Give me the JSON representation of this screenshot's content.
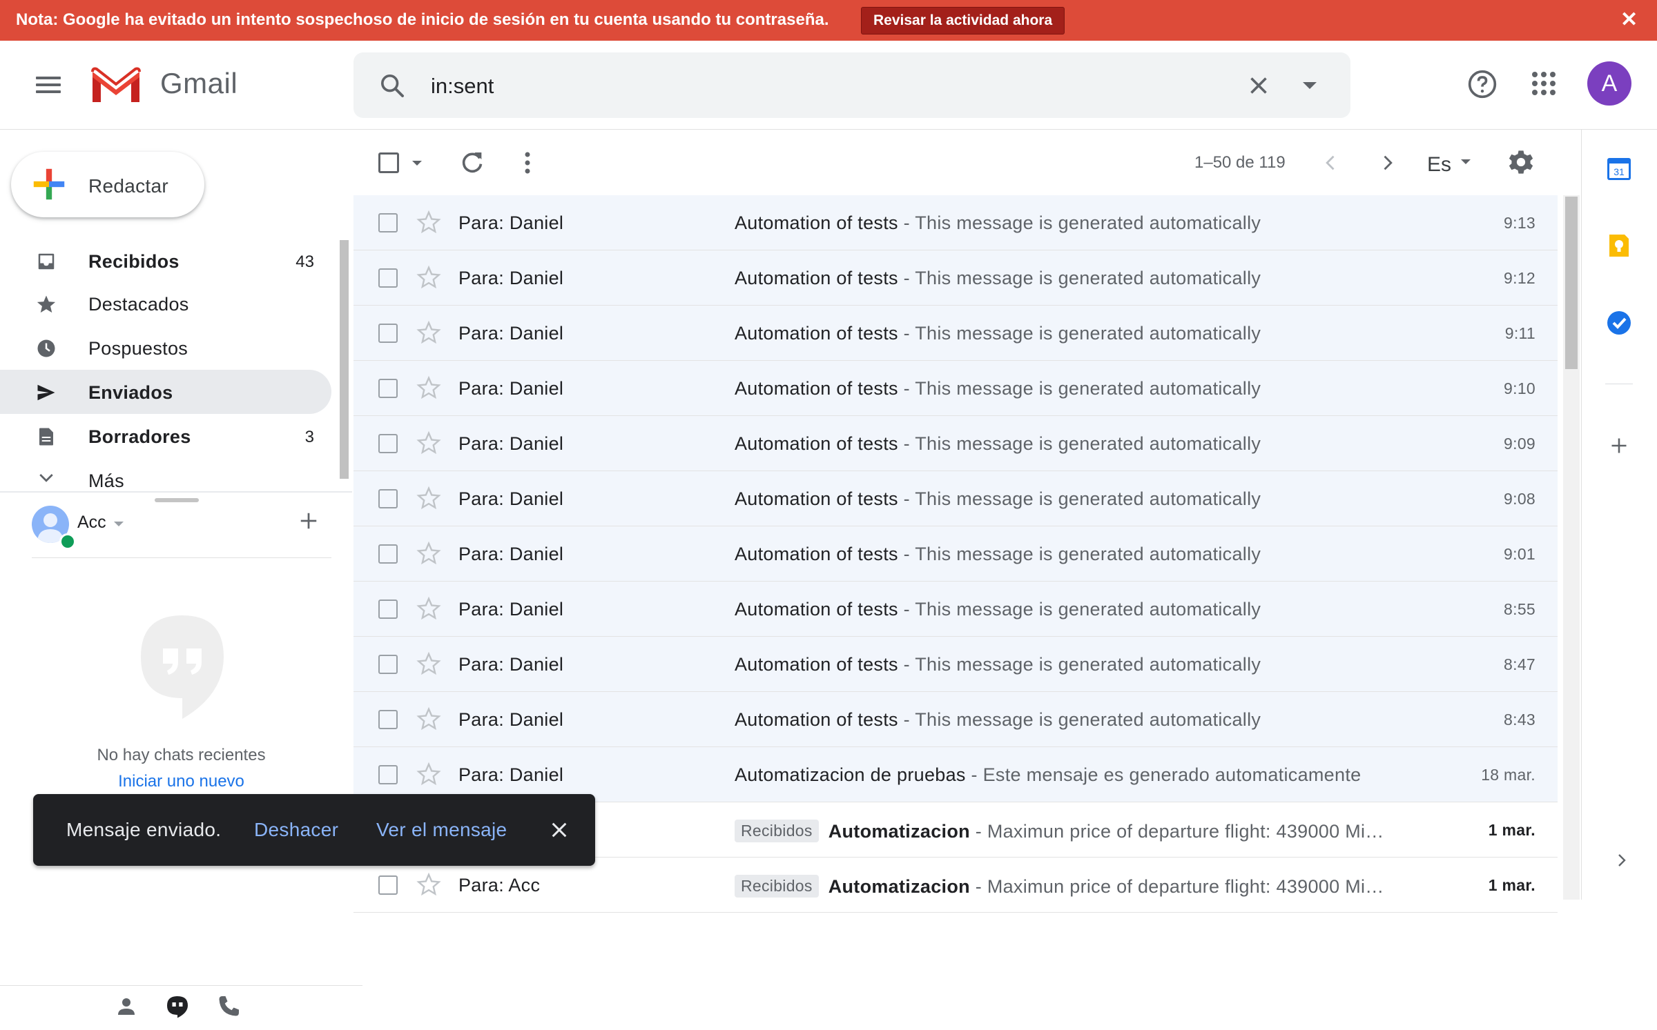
{
  "banner": {
    "message": "Nota: Google ha evitado un intento sospechoso de inicio de sesión en tu cuenta usando tu contraseña.",
    "action_label": "Revisar la actividad ahora",
    "color": "#dd4b39"
  },
  "header": {
    "app_name": "Gmail",
    "search": {
      "value": "in:sent"
    },
    "avatar_letter": "A",
    "avatar_color": "#7b3fbf"
  },
  "sidebar": {
    "compose_label": "Redactar",
    "items": [
      {
        "label": "Recibidos",
        "count": "43",
        "icon": "inbox-icon",
        "bold": true
      },
      {
        "label": "Destacados",
        "count": "",
        "icon": "star-icon",
        "bold": false
      },
      {
        "label": "Pospuestos",
        "count": "",
        "icon": "clock-icon",
        "bold": false
      },
      {
        "label": "Enviados",
        "count": "",
        "icon": "send-icon",
        "bold": true,
        "active": true
      },
      {
        "label": "Borradores",
        "count": "3",
        "icon": "draft-icon",
        "bold": true
      },
      {
        "label": "Más",
        "count": "",
        "icon": "chevron-down-icon",
        "bold": false
      }
    ]
  },
  "hangouts": {
    "user_name": "Acc",
    "no_chats": "No hay chats recientes",
    "start_new": "Iniciar uno nuevo"
  },
  "toolbar": {
    "pager": "1–50 de 119",
    "language": "Es"
  },
  "messages": [
    {
      "sender": "Para: Daniel",
      "label": "",
      "subject": "Automation of tests",
      "snippet": " - This message is generated automatically",
      "time": "9:13",
      "unread": false
    },
    {
      "sender": "Para: Daniel",
      "label": "",
      "subject": "Automation of tests",
      "snippet": " - This message is generated automatically",
      "time": "9:12",
      "unread": false
    },
    {
      "sender": "Para: Daniel",
      "label": "",
      "subject": "Automation of tests",
      "snippet": " - This message is generated automatically",
      "time": "9:11",
      "unread": false
    },
    {
      "sender": "Para: Daniel",
      "label": "",
      "subject": "Automation of tests",
      "snippet": " - This message is generated automatically",
      "time": "9:10",
      "unread": false
    },
    {
      "sender": "Para: Daniel",
      "label": "",
      "subject": "Automation of tests",
      "snippet": " - This message is generated automatically",
      "time": "9:09",
      "unread": false
    },
    {
      "sender": "Para: Daniel",
      "label": "",
      "subject": "Automation of tests",
      "snippet": " - This message is generated automatically",
      "time": "9:08",
      "unread": false
    },
    {
      "sender": "Para: Daniel",
      "label": "",
      "subject": "Automation of tests",
      "snippet": " - This message is generated automatically",
      "time": "9:01",
      "unread": false
    },
    {
      "sender": "Para: Daniel",
      "label": "",
      "subject": "Automation of tests",
      "snippet": " - This message is generated automatically",
      "time": "8:55",
      "unread": false
    },
    {
      "sender": "Para: Daniel",
      "label": "",
      "subject": "Automation of tests",
      "snippet": " - This message is generated automatically",
      "time": "8:47",
      "unread": false
    },
    {
      "sender": "Para: Daniel",
      "label": "",
      "subject": "Automation of tests",
      "snippet": " - This message is generated automatically",
      "time": "8:43",
      "unread": false
    },
    {
      "sender": "Para: Daniel",
      "label": "",
      "subject": "Automatizacion de pruebas",
      "snippet": " - Este mensaje es generado automaticamente",
      "time": "18 mar.",
      "unread": false
    },
    {
      "sender": "",
      "label": "Recibidos",
      "subject": "Automatizacion",
      "snippet": " - Maximun price of departure flight: 439000 Mi…",
      "time": "1 mar.",
      "unread": true
    },
    {
      "sender": "Para: Acc",
      "label": "Recibidos",
      "subject": "Automatizacion",
      "snippet": " - Maximun price of departure flight: 439000 Mi…",
      "time": "1 mar.",
      "unread": true
    }
  ],
  "snackbar": {
    "message": "Mensaje enviado.",
    "undo_label": "Deshacer",
    "view_label": "Ver el mensaje"
  }
}
